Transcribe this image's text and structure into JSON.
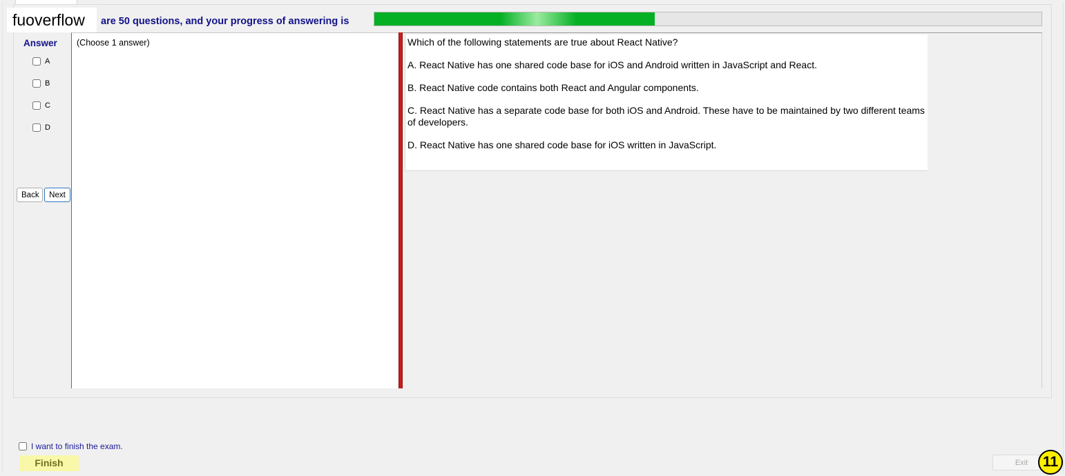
{
  "watermark": "fuoverflow",
  "progress": {
    "text": "are 50 questions, and your progress of answering is",
    "fraction": 0.42,
    "fill_color": "#06b025"
  },
  "answer_panel": {
    "heading": "Answer",
    "options": [
      "A",
      "B",
      "C",
      "D"
    ],
    "back_label": "Back",
    "next_label": "Next"
  },
  "left_pane": {
    "instruction": "(Choose 1 answer)"
  },
  "question": {
    "prompt": "Which of the following statements are true about React Native?",
    "choices": [
      "A.  React Native has one shared code base for iOS and Android written in JavaScript and React.",
      "B.  React Native code contains both React and Angular components.",
      "C.  React Native has a separate code base for both iOS and Android. These have to be maintained by two different teams of developers.",
      "D.  React Native has one shared code base for iOS written in JavaScript."
    ]
  },
  "footer": {
    "finish_checkbox_label": "I want to finish the exam.",
    "finish_label": "Finish",
    "exit_label": "Exit",
    "page_number": "11"
  },
  "colors": {
    "splitter": "#cc1b1b",
    "finish_bg": "#f8f8a8",
    "badge": "#ffee00",
    "heading_text": "#12128a"
  }
}
